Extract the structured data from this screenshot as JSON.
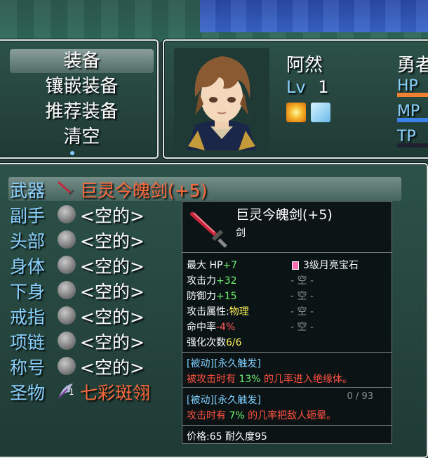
{
  "command_menu": {
    "items": [
      "装备",
      "镶嵌装备",
      "推荐装备",
      "清空"
    ],
    "selected_index": 0
  },
  "actor": {
    "name": "阿然",
    "class": "勇者",
    "level_label": "Lv",
    "level": "1",
    "gauges": [
      {
        "label": "HP",
        "color": "#f08030",
        "fill": 1.0
      },
      {
        "label": "MP",
        "color": "#3b82e8",
        "fill": 1.0
      },
      {
        "label": "TP",
        "color": "#3a3a55",
        "fill": 0.0
      }
    ],
    "state_icons": [
      "burst-state-icon",
      "wind-state-icon"
    ]
  },
  "slots": [
    {
      "label": "武器",
      "item": "巨灵今魄剑(+5)",
      "icon": "sword-icon",
      "selected": true,
      "highlight": true
    },
    {
      "label": "副手",
      "item": "<空的>",
      "icon": "empty-slot-icon"
    },
    {
      "label": "头部",
      "item": "<空的>",
      "icon": "empty-slot-icon"
    },
    {
      "label": "身体",
      "item": "<空的>",
      "icon": "empty-slot-icon"
    },
    {
      "label": "下身",
      "item": "<空的>",
      "icon": "empty-slot-icon"
    },
    {
      "label": "戒指",
      "item": "<空的>",
      "icon": "empty-slot-icon"
    },
    {
      "label": "项链",
      "item": "<空的>",
      "icon": "empty-slot-icon"
    },
    {
      "label": "称号",
      "item": "<空的>",
      "icon": "empty-slot-icon"
    },
    {
      "label": "圣物",
      "item": "七彩斑翎",
      "icon": "feather-icon",
      "badge": "1",
      "highlight": true
    }
  ],
  "tooltip": {
    "name": "巨灵今魄剑(+5)",
    "type": "剑",
    "stats": [
      {
        "key": "最大 HP",
        "value": "+7",
        "color": "g"
      },
      {
        "key": "攻击力",
        "value": "+32",
        "color": "g"
      },
      {
        "key": "防御力",
        "value": "+15",
        "color": "g"
      },
      {
        "key": "攻击属性:",
        "value": "物理",
        "color": "y"
      },
      {
        "key": "命中率",
        "value": "-4%",
        "color": "r"
      },
      {
        "key": "强化次数",
        "value": "6/6",
        "color": "y"
      }
    ],
    "sockets": [
      "3级月亮宝石",
      "- 空 -",
      "- 空 -",
      "- 空 -",
      "- 空 -"
    ],
    "passives": [
      {
        "tag": "[被动]",
        "kind": "[永久触发]",
        "pre": "被攻击时有 ",
        "pct": "13%",
        "post": " 的几率进入绝缘体。"
      },
      {
        "tag": "[被动]",
        "kind": "[永久触发]",
        "pre": "攻击时有 ",
        "pct": "7%",
        "post": " 的几率把敌人砸晕。"
      }
    ],
    "counter": "0 / 93",
    "price": "价格:65 耐久度95"
  }
}
